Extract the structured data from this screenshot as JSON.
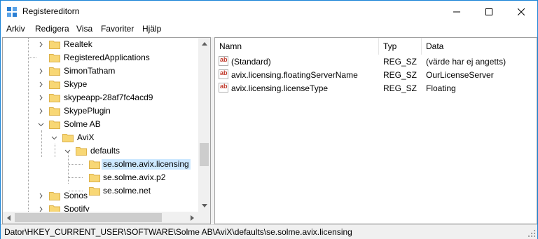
{
  "window": {
    "title": "Registereditorn"
  },
  "menu": [
    "Arkiv",
    "Redigera",
    "Visa",
    "Favoriter",
    "Hjälp"
  ],
  "tree": {
    "nodes": [
      {
        "label": "Realtek"
      },
      {
        "label": "RegisteredApplications"
      },
      {
        "label": "SimonTatham"
      },
      {
        "label": "Skype"
      },
      {
        "label": "skypeapp-28af7fc4acd9"
      },
      {
        "label": "SkypePlugin"
      },
      {
        "label": "Solme AB"
      },
      {
        "label": "AviX"
      },
      {
        "label": "defaults"
      },
      {
        "label": "se.solme.avix.licensing"
      },
      {
        "label": "se.solme.avix.p2"
      },
      {
        "label": "se.solme.net"
      },
      {
        "label": "Sonos"
      },
      {
        "label": "Spotify"
      }
    ]
  },
  "list": {
    "columns": [
      "Namn",
      "Typ",
      "Data"
    ],
    "rows": [
      {
        "name": "(Standard)",
        "type": "REG_SZ",
        "data": "(värde har ej angetts)",
        "icon": "string-value-icon"
      },
      {
        "name": "avix.licensing.floatingServerName",
        "type": "REG_SZ",
        "data": "OurLicenseServer",
        "icon": "string-value-icon"
      },
      {
        "name": "avix.licensing.licenseType",
        "type": "REG_SZ",
        "data": "Floating",
        "icon": "string-value-icon"
      }
    ]
  },
  "status": {
    "path": "Dator\\HKEY_CURRENT_USER\\SOFTWARE\\Solme AB\\AviX\\defaults\\se.solme.avix.licensing"
  },
  "colors": {
    "selection": "#cce8ff",
    "folder": "#f8d775",
    "folder_edge": "#dcb14a",
    "border": "#1883d7"
  }
}
